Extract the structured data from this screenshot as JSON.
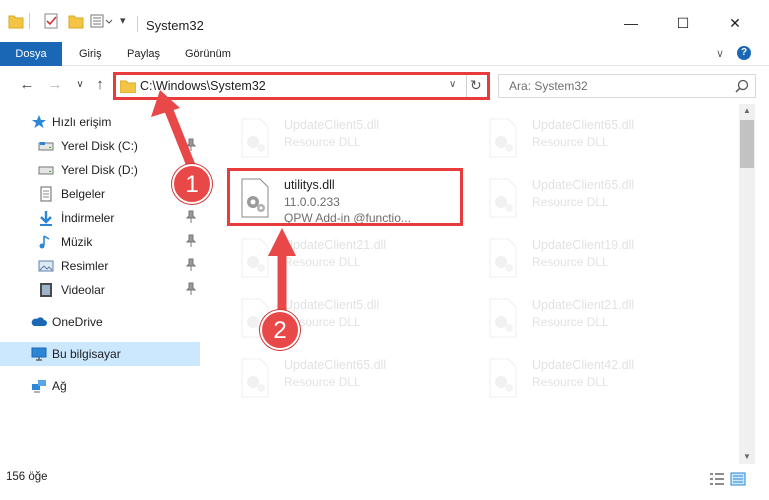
{
  "window": {
    "title": "System32",
    "minimize": "—",
    "maximize": "☐",
    "close": "✕"
  },
  "ribbon": {
    "tabs": [
      "Dosya",
      "Giriş",
      "Paylaş",
      "Görünüm"
    ],
    "expand_label": "∨",
    "help_label": "?"
  },
  "address": {
    "path": "C:\\Windows\\System32",
    "search_placeholder": "Ara: System32"
  },
  "sidebar": {
    "items": [
      {
        "label": "Hızlı erişim",
        "icon": "star-icon"
      },
      {
        "label": "Yerel Disk (C:)",
        "icon": "drive-icon",
        "pinned": true
      },
      {
        "label": "Yerel Disk (D:)",
        "icon": "drive-icon"
      },
      {
        "label": "Belgeler",
        "icon": "documents-icon",
        "pinned": true
      },
      {
        "label": "İndirmeler",
        "icon": "downloads-icon",
        "pinned": true
      },
      {
        "label": "Müzik",
        "icon": "music-icon",
        "pinned": true
      },
      {
        "label": "Resimler",
        "icon": "pictures-icon",
        "pinned": true
      },
      {
        "label": "Videolar",
        "icon": "videos-icon",
        "pinned": true
      },
      {
        "label": "OneDrive",
        "icon": "cloud-icon"
      },
      {
        "label": "Bu bilgisayar",
        "icon": "computer-icon",
        "selected": true
      },
      {
        "label": "Ağ",
        "icon": "network-icon"
      }
    ]
  },
  "files": {
    "left": [
      {
        "name": "UpdateClient5.dll",
        "type": "Resource DLL"
      },
      {
        "name": "utilitys.dll",
        "version": "11.0.0.233",
        "desc": "QPW Add-in @functio..."
      },
      {
        "name": "UpdateClient21.dll",
        "type": "Resource DLL"
      },
      {
        "name": "UpdateClient5.dll",
        "type": "Resource DLL"
      },
      {
        "name": "UpdateClient65.dll",
        "type": "Resource DLL"
      }
    ],
    "right": [
      {
        "name": "UpdateClient65.dll",
        "type": "Resource DLL"
      },
      {
        "name": "UpdateClient65.dll",
        "type": "Resource DLL"
      },
      {
        "name": "UpdateClient19.dll",
        "type": "Resource DLL"
      },
      {
        "name": "UpdateClient21.dll",
        "type": "Resource DLL"
      },
      {
        "name": "UpdateClient42.dll",
        "type": "Resource DLL"
      }
    ]
  },
  "status": {
    "count": "156 öğe"
  },
  "annotations": {
    "step1": "1",
    "step2": "2"
  },
  "colors": {
    "accent": "#1a67b6",
    "highlight": "#e83c3c",
    "selected": "#cce8ff"
  }
}
